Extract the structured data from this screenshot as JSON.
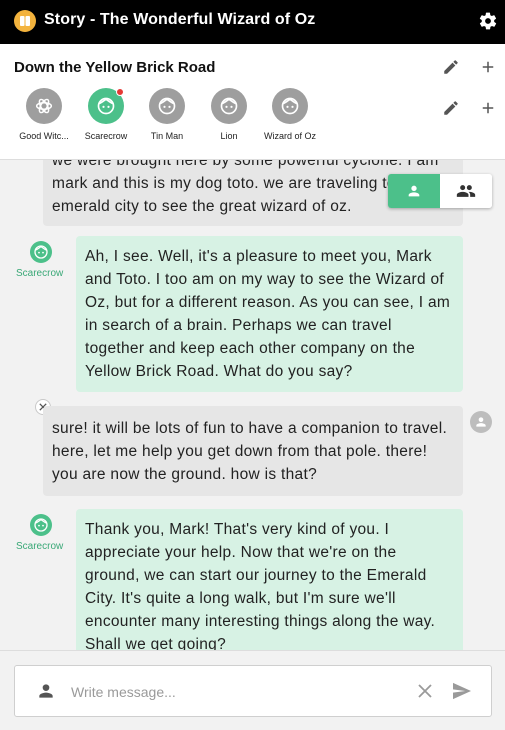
{
  "app": {
    "title": "Story - The Wonderful Wizard of Oz"
  },
  "chapter": {
    "title": "Down the Yellow Brick Road"
  },
  "characters": [
    {
      "label": "Good Witc...",
      "active": false,
      "icon": "openai-icon"
    },
    {
      "label": "Scarecrow",
      "active": true,
      "icon": "face-icon",
      "notification": true
    },
    {
      "label": "Tin Man",
      "active": false,
      "icon": "face-icon"
    },
    {
      "label": "Lion",
      "active": false,
      "icon": "face-icon"
    },
    {
      "label": "Wizard of Oz",
      "active": false,
      "icon": "face-icon"
    }
  ],
  "messages": [
    {
      "role": "user",
      "text": "we were brought here by some powerful cyclone. I am mark and this is my dog toto. we are traveling to emerald city to see the great wizard of oz."
    },
    {
      "role": "bot",
      "name": "Scarecrow",
      "text": "Ah, I see. Well, it's a pleasure to meet you, Mark and Toto. I too am on my way to see the Wizard of Oz, but for a different reason. As you can see, I am in search of a brain. Perhaps we can travel together and keep each other company on the Yellow Brick Road. What do you say?"
    },
    {
      "role": "user",
      "text": "sure! it will be lots of fun to have a companion to travel. here, let me help you get down from that pole. there! you are now the ground. how is that?"
    },
    {
      "role": "bot",
      "name": "Scarecrow",
      "text": "Thank you, Mark! That's very kind of you. I appreciate your help. Now that we're on the ground, we can start our journey to the Emerald City. It's quite a long walk, but I'm sure we'll encounter many interesting things along the way. Shall we get going?"
    }
  ],
  "input": {
    "placeholder": "Write message..."
  },
  "colors": {
    "accent": "#4cc08a",
    "bot_bubble": "#d7f2e4",
    "user_bubble": "#e6e6e6",
    "appbar": "#000000"
  }
}
